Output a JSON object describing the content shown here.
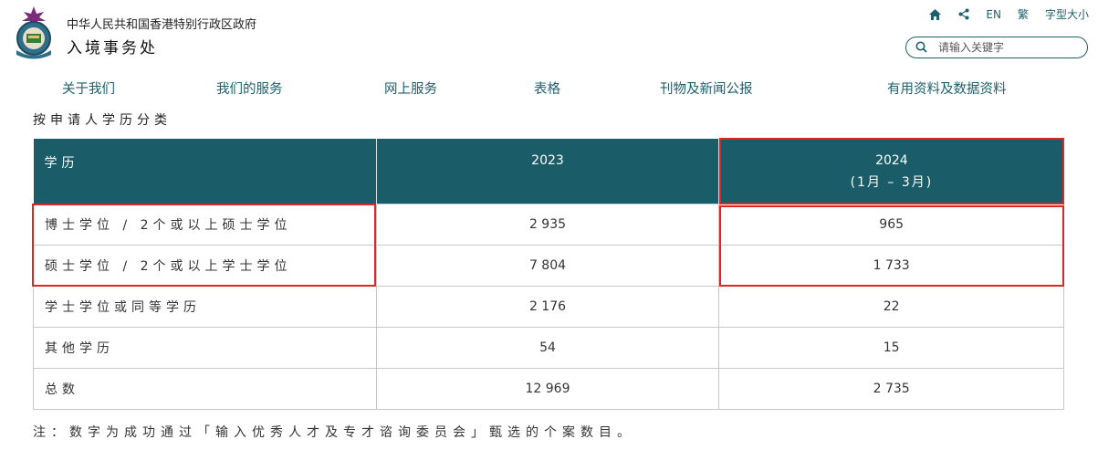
{
  "header": {
    "gov_name": "中华人民共和国香港特别行政区政府",
    "dept_name": "入境事务处",
    "logo_icon": "immd-emblem-icon"
  },
  "utility": {
    "home_icon": "home-icon",
    "share_icon": "share-icon",
    "lang_en": "EN",
    "lang_tc": "繁",
    "font_size": "字型大小"
  },
  "search": {
    "placeholder": "请输入关键字",
    "icon": "search-icon"
  },
  "nav": {
    "items": [
      "关于我们",
      "我们的服务",
      "网上服务",
      "表格",
      "刊物及新闻公报",
      "有用资料及数据资料"
    ]
  },
  "section_title": "按申请人学历分类",
  "table": {
    "headers": {
      "col0": "学历",
      "col1": "2023",
      "col2": "2024",
      "col2_sub": "(1月 – 3月)"
    },
    "rows": [
      {
        "label": "博士学位 / 2个或以上硕士学位",
        "y2023": "2 935",
        "y2024": "965"
      },
      {
        "label": "硕士学位 / 2个或以上学士学位",
        "y2023": "7 804",
        "y2024": "1 733"
      },
      {
        "label": "学士学位或同等学历",
        "y2023": "2 176",
        "y2024": "22"
      },
      {
        "label": "其他学历",
        "y2023": "54",
        "y2024": "15"
      },
      {
        "label": "总数",
        "y2023": "12 969",
        "y2024": "2 735"
      }
    ]
  },
  "note": "注：数字为成功通过「输入优秀人才及专才谘询委员会」甄选的个案数目。",
  "colors": {
    "header_bg": "#1a5d68",
    "nav_text": "#1d5f6c",
    "highlight": "#e02424"
  }
}
